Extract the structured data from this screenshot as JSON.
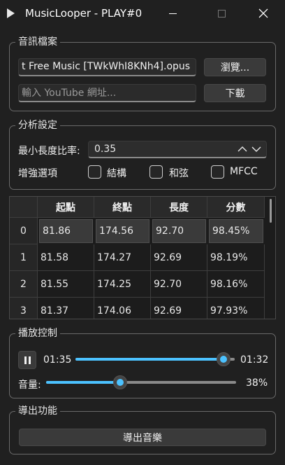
{
  "window": {
    "title": "MusicLooper - PLAY#0",
    "app_icon": "play-triangle-icon"
  },
  "audio_file": {
    "group_title": "音訊檔案",
    "file_value": "t Free Music [TWkWhI8KNh4].opus",
    "browse_label": "瀏覽...",
    "youtube_placeholder": "輸入 YouTube 網址...",
    "download_label": "下載"
  },
  "analysis": {
    "group_title": "分析設定",
    "min_ratio_label": "最小長度比率:",
    "min_ratio_value": "0.35",
    "enhance_label": "增強選項",
    "options": [
      {
        "label": "結構",
        "checked": false
      },
      {
        "label": "和弦",
        "checked": false
      },
      {
        "label": "MFCC",
        "checked": false
      }
    ]
  },
  "table": {
    "headers": [
      "起點",
      "終點",
      "長度",
      "分數"
    ],
    "rows": [
      {
        "index": "0",
        "cells": [
          "81.86",
          "174.56",
          "92.70",
          "98.45%"
        ]
      },
      {
        "index": "1",
        "cells": [
          "81.58",
          "174.27",
          "92.69",
          "98.19%"
        ]
      },
      {
        "index": "2",
        "cells": [
          "81.55",
          "174.25",
          "92.70",
          "98.16%"
        ]
      },
      {
        "index": "3",
        "cells": [
          "81.37",
          "174.06",
          "92.69",
          "97.93%"
        ]
      }
    ],
    "selected_row": 0
  },
  "playback": {
    "group_title": "播放控制",
    "current_time": "01:35",
    "end_time": "01:32",
    "progress_fraction": 0.97,
    "volume_label": "音量:",
    "volume_percent_text": "38%",
    "volume_fraction": 0.38
  },
  "export": {
    "group_title": "導出功能",
    "export_button": "導出音樂"
  },
  "colors": {
    "accent": "#4cc2ff",
    "background": "#202020"
  }
}
